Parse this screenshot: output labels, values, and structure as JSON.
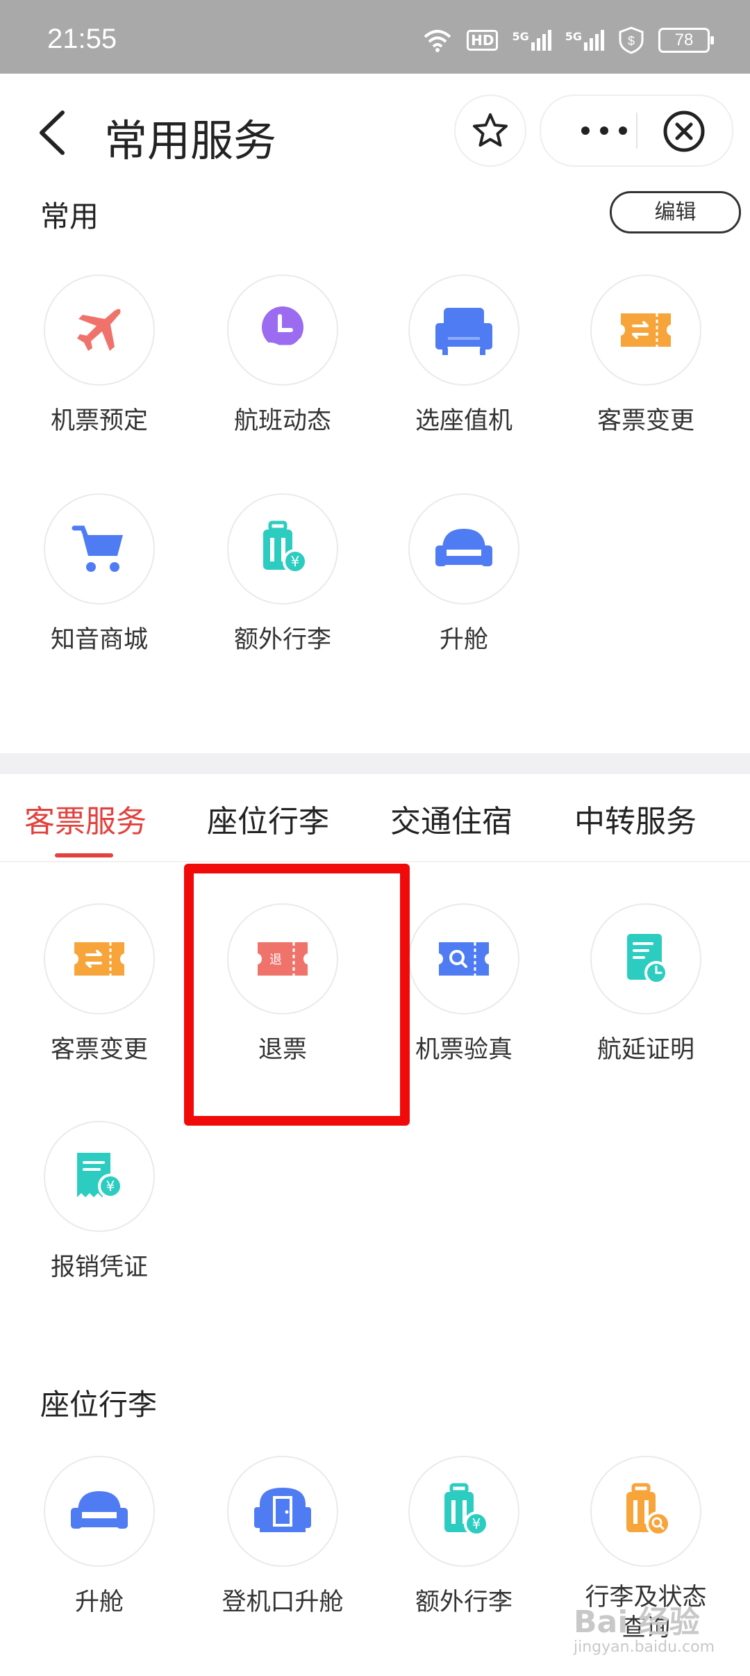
{
  "status_bar": {
    "time": "21:55",
    "battery": "78",
    "hd_label": "HD",
    "network_label": "5G"
  },
  "header": {
    "title": "常用服务"
  },
  "common": {
    "section_title": "常用",
    "edit_label": "编辑",
    "items": [
      {
        "label": "机票预定",
        "icon": "airplane-icon"
      },
      {
        "label": "航班动态",
        "icon": "clock-hand-icon"
      },
      {
        "label": "选座值机",
        "icon": "seat-icon"
      },
      {
        "label": "客票变更",
        "icon": "ticket-change-icon"
      },
      {
        "label": "知音商城",
        "icon": "shopping-cart-icon"
      },
      {
        "label": "额外行李",
        "icon": "luggage-yuan-icon"
      },
      {
        "label": "升舱",
        "icon": "upgrade-seat-icon"
      }
    ]
  },
  "tabs": [
    {
      "label": "客票服务",
      "active": true
    },
    {
      "label": "座位行李",
      "active": false
    },
    {
      "label": "交通住宿",
      "active": false
    },
    {
      "label": "中转服务",
      "active": false
    }
  ],
  "ticket_services": {
    "items": [
      {
        "label": "客票变更",
        "icon": "ticket-change-icon"
      },
      {
        "label": "退票",
        "icon": "refund-ticket-icon",
        "icon_text": "退"
      },
      {
        "label": "机票验真",
        "icon": "ticket-verify-icon"
      },
      {
        "label": "航延证明",
        "icon": "delay-certificate-icon"
      },
      {
        "label": "报销凭证",
        "icon": "receipt-yuan-icon"
      }
    ]
  },
  "seat_luggage": {
    "section_title": "座位行李",
    "items": [
      {
        "label": "升舱",
        "icon": "upgrade-seat-icon"
      },
      {
        "label": "登机口升舱",
        "icon": "gate-upgrade-icon"
      },
      {
        "label": "额外行李",
        "icon": "luggage-yuan-icon"
      },
      {
        "label": "行李及状态查询",
        "icon": "luggage-search-icon"
      }
    ]
  },
  "watermark": {
    "text": "Bai 经验",
    "sub": "jingyan.baidu.com"
  },
  "colors": {
    "accent": "#e2413e",
    "highlight": "#f00a0a",
    "orange": "#f7a43a",
    "blue": "#4f7cf3",
    "teal": "#2ccdc0",
    "purple": "#9b6cf0",
    "salmon": "#f0736b"
  }
}
